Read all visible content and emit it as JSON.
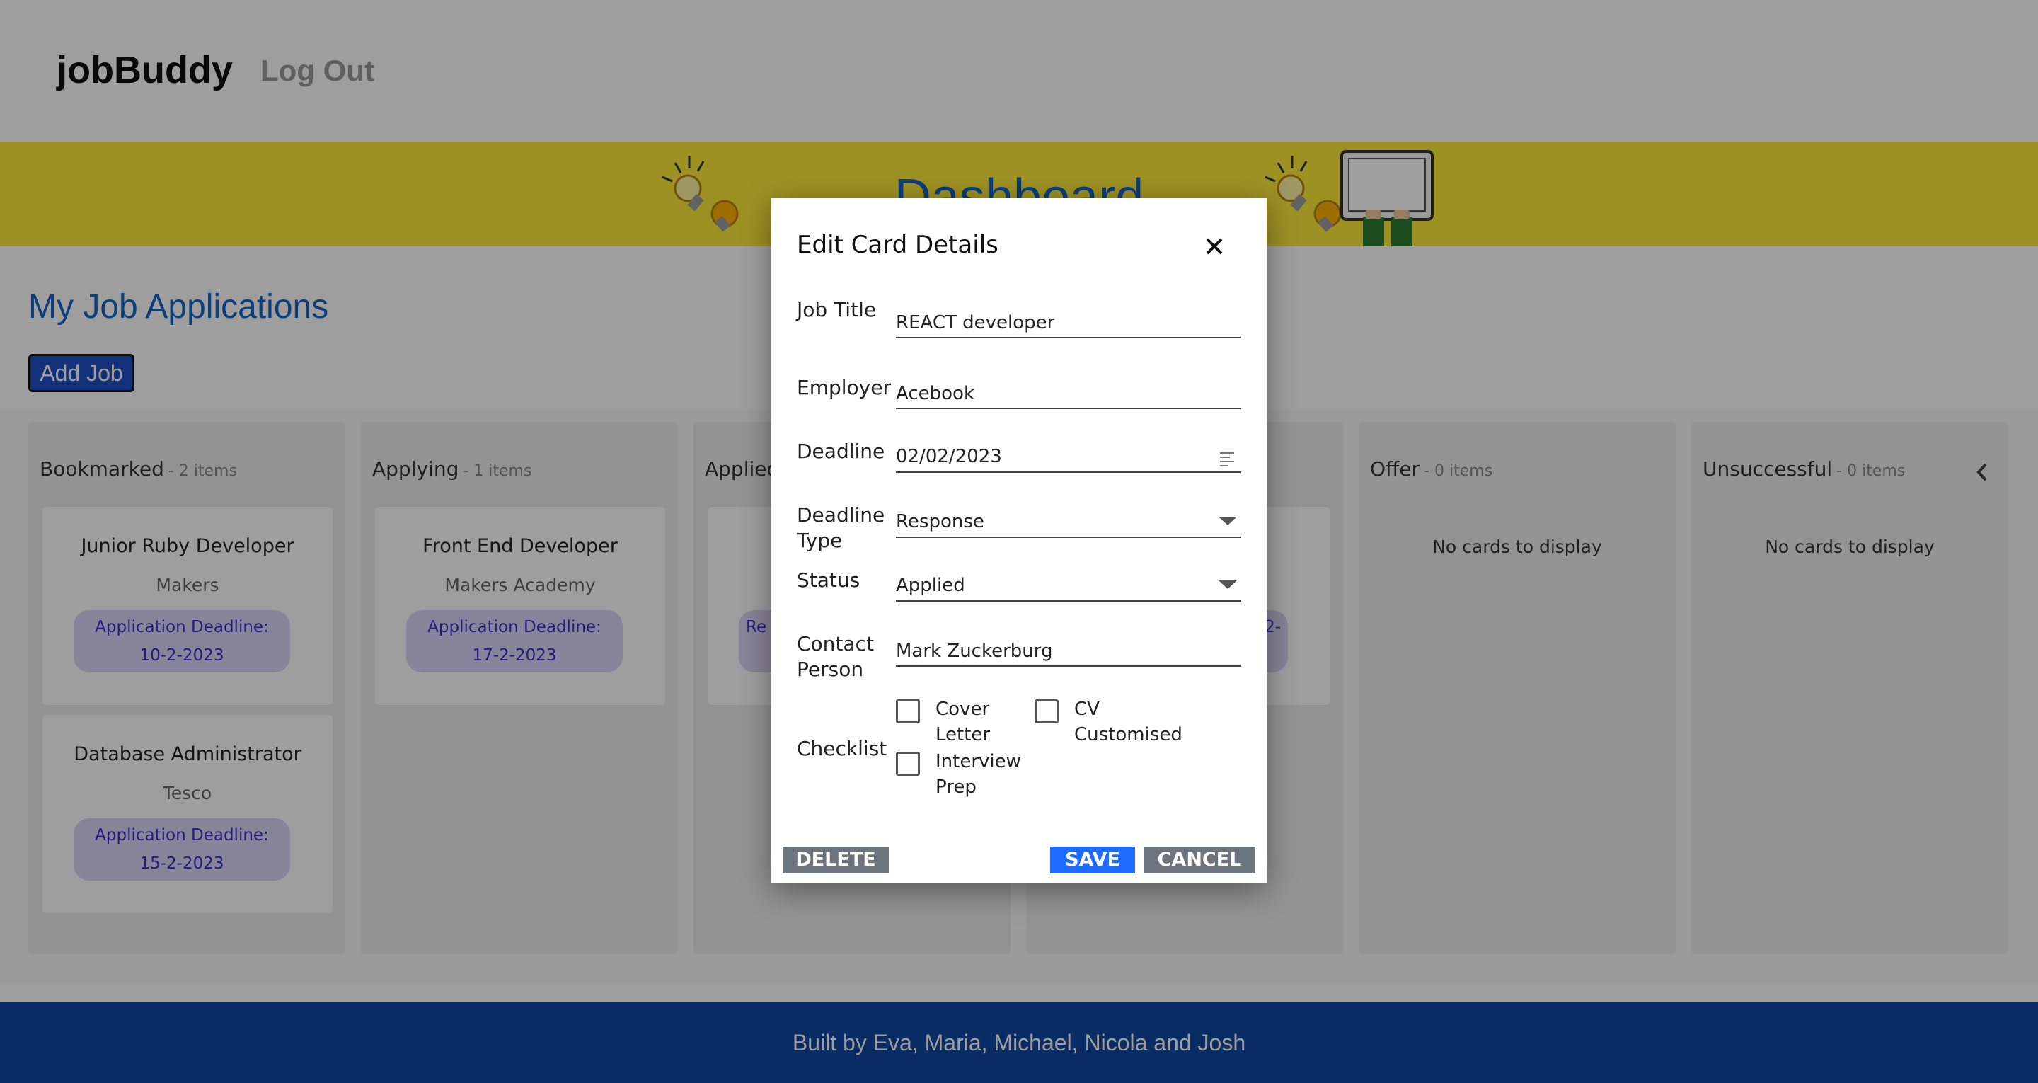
{
  "header": {
    "brand": "jobBuddy",
    "logout": "Log Out"
  },
  "banner": {
    "title": "Dashboard"
  },
  "main": {
    "title": "My Job Applications",
    "add_job": "Add Job"
  },
  "columns": [
    {
      "name": "Bookmarked",
      "count": "- 2 items"
    },
    {
      "name": "Applying",
      "count": "- 1 items"
    },
    {
      "name": "Applied",
      "count": ""
    },
    {
      "name": "",
      "count": ""
    },
    {
      "name": "Offer",
      "count": "- 0 items",
      "empty": "No cards to display"
    },
    {
      "name": "Unsuccessful",
      "count": "- 0 items",
      "empty": "No cards to display"
    }
  ],
  "cards": [
    {
      "title": "Junior Ruby Developer",
      "employer": "Makers",
      "deadline": "Application Deadline: 10-2-2023"
    },
    {
      "title": "Database Administrator",
      "employer": "Tesco",
      "deadline": "Application Deadline: 15-2-2023"
    },
    {
      "title": "Front End Developer",
      "employer": "Makers Academy",
      "deadline": "Application Deadline: 17-2-2023"
    },
    {
      "deadline_fragment": "Re"
    },
    {
      "deadline_fragment": "2-"
    }
  ],
  "footer": {
    "text": "Built by Eva, Maria, Michael, Nicola and Josh"
  },
  "modal": {
    "title": "Edit Card Details",
    "labels": {
      "job_title": "Job Title",
      "employer": "Employer",
      "deadline": "Deadline",
      "deadline_type_1": "Deadline",
      "deadline_type_2": "Type",
      "status": "Status",
      "contact_1": "Contact",
      "contact_2": "Person",
      "checklist": "Checklist"
    },
    "values": {
      "job_title": "REACT developer",
      "employer": "Acebook",
      "deadline": "02/02/2023",
      "deadline_type": "Response",
      "status": "Applied",
      "contact": "Mark Zuckerburg"
    },
    "checklist": {
      "cover_1": "Cover",
      "cover_2": "Letter",
      "cv_1": "CV",
      "cv_2": "Customised",
      "interview_1": "Interview",
      "interview_2": "Prep"
    },
    "buttons": {
      "delete": "DELETE",
      "save": "SAVE",
      "cancel": "CANCEL"
    }
  },
  "colors": {
    "banner": "#ffeb3b",
    "accent": "#1565c0",
    "footer": "#0d47a1",
    "save": "#1e6bff",
    "secondary": "#6c757d",
    "deadline_chip": "#dcd6f7"
  },
  "icons": [
    "close-icon",
    "calendar-icon",
    "chevron-down-icon",
    "chevron-left-icon",
    "lightbulb-icon",
    "laptop-icon"
  ]
}
